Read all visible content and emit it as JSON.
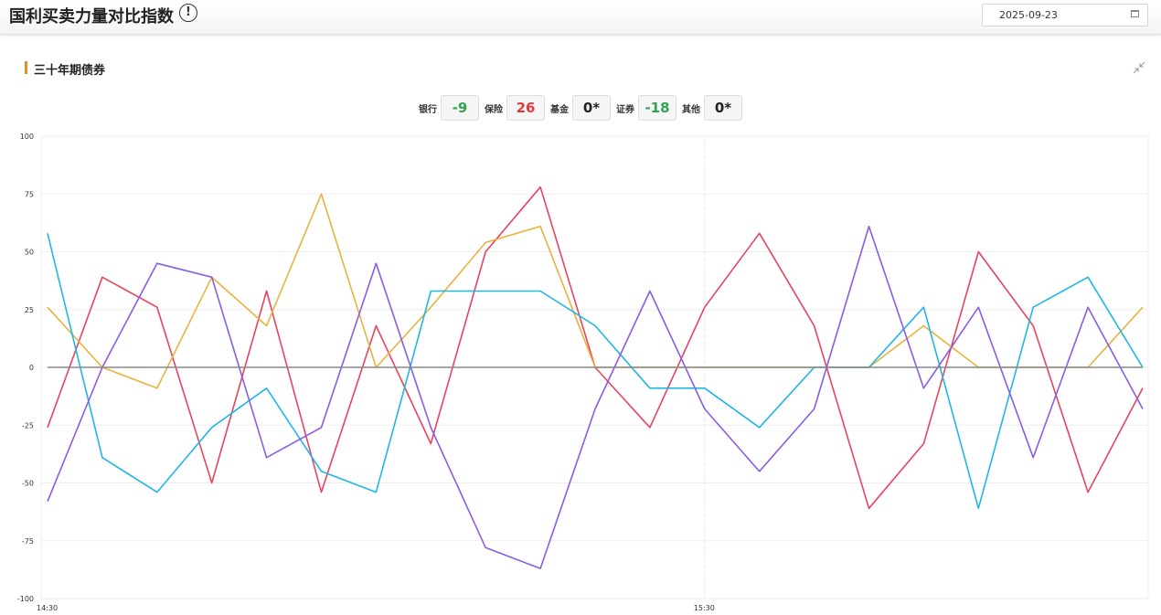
{
  "header": {
    "title": "国利买卖力量对比指数",
    "info_icon": "!",
    "date": "2025-09-23"
  },
  "section": {
    "title": "三十年期债券"
  },
  "stats": [
    {
      "label": "银行",
      "value": "-9",
      "color": "#2ea44f"
    },
    {
      "label": "保险",
      "value": "26",
      "color": "#e0393e"
    },
    {
      "label": "基金",
      "value": "0*",
      "color": "#222222"
    },
    {
      "label": "证券",
      "value": "-18",
      "color": "#2ea44f"
    },
    {
      "label": "其他",
      "value": "0*",
      "color": "#222222"
    }
  ],
  "colors": {
    "accent": "#f08a24"
  },
  "chart_data": {
    "type": "line",
    "title": "",
    "xlabel": "",
    "ylabel": "",
    "ylim": [
      -100,
      100
    ],
    "yticks": [
      100,
      75,
      50,
      25,
      0,
      -25,
      -50,
      -75,
      -100
    ],
    "x_tick_labels": [
      {
        "label": "14:30",
        "index": 0
      },
      {
        "label": "15:30",
        "index": 12
      }
    ],
    "grid": true,
    "legend": "none",
    "x_count": 21,
    "series": [
      {
        "color": "#e9435e",
        "values": [
          -26,
          39,
          26,
          -50,
          33,
          -54,
          18,
          -33,
          50,
          78,
          0,
          -26,
          26,
          58,
          18,
          -61,
          -33,
          50,
          18,
          -54,
          -9
        ]
      },
      {
        "color": "#e8b33c",
        "values": [
          26,
          0,
          -9,
          39,
          18,
          75,
          0,
          26,
          54,
          61,
          0,
          0,
          0,
          0,
          0,
          0,
          18,
          0,
          0,
          0,
          26
        ]
      },
      {
        "color": "#1fb7e8",
        "values": [
          58,
          -39,
          -54,
          -26,
          -9,
          -45,
          -54,
          33,
          33,
          33,
          18,
          -9,
          -9,
          -26,
          0,
          0,
          26,
          -61,
          26,
          39,
          0
        ]
      },
      {
        "color": "#8a5be6",
        "values": [
          -58,
          0,
          45,
          39,
          -39,
          -26,
          45,
          -26,
          -78,
          -87,
          -18,
          33,
          -18,
          -45,
          -18,
          61,
          -9,
          26,
          -39,
          26,
          -18
        ]
      },
      {
        "color": "#888888",
        "values": [
          0,
          0,
          0,
          0,
          0,
          0,
          0,
          0,
          0,
          0,
          0,
          0,
          0,
          0,
          0,
          0,
          0,
          0,
          0,
          0,
          0
        ]
      }
    ]
  }
}
